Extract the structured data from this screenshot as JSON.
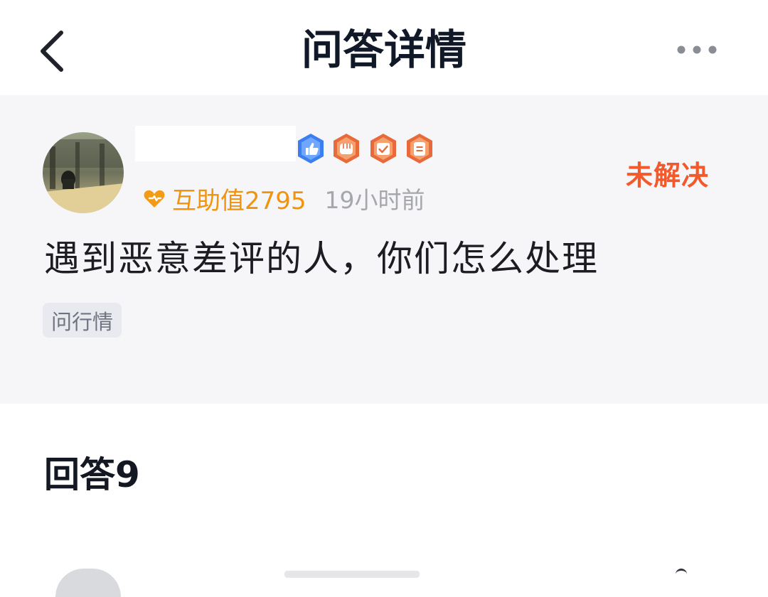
{
  "header": {
    "title": "问答详情",
    "back_icon": "chevron-left-icon",
    "more_icon": "more-horizontal-icon"
  },
  "question": {
    "status": "未解决",
    "user": {
      "badges": [
        "like-badge-icon",
        "fist-badge-icon",
        "check-badge-icon",
        "calendar-badge-icon"
      ]
    },
    "points_label": "互助值2795",
    "time": "19小时前",
    "text": "遇到恶意差评的人，你们怎么处理",
    "tag": "问行情"
  },
  "answers": {
    "title": "回答9"
  },
  "colors": {
    "accent_orange": "#f25a2b",
    "points_gold": "#f0930f",
    "badge_blue": "#3b7ef0",
    "badge_orange": "#f07a3a"
  }
}
